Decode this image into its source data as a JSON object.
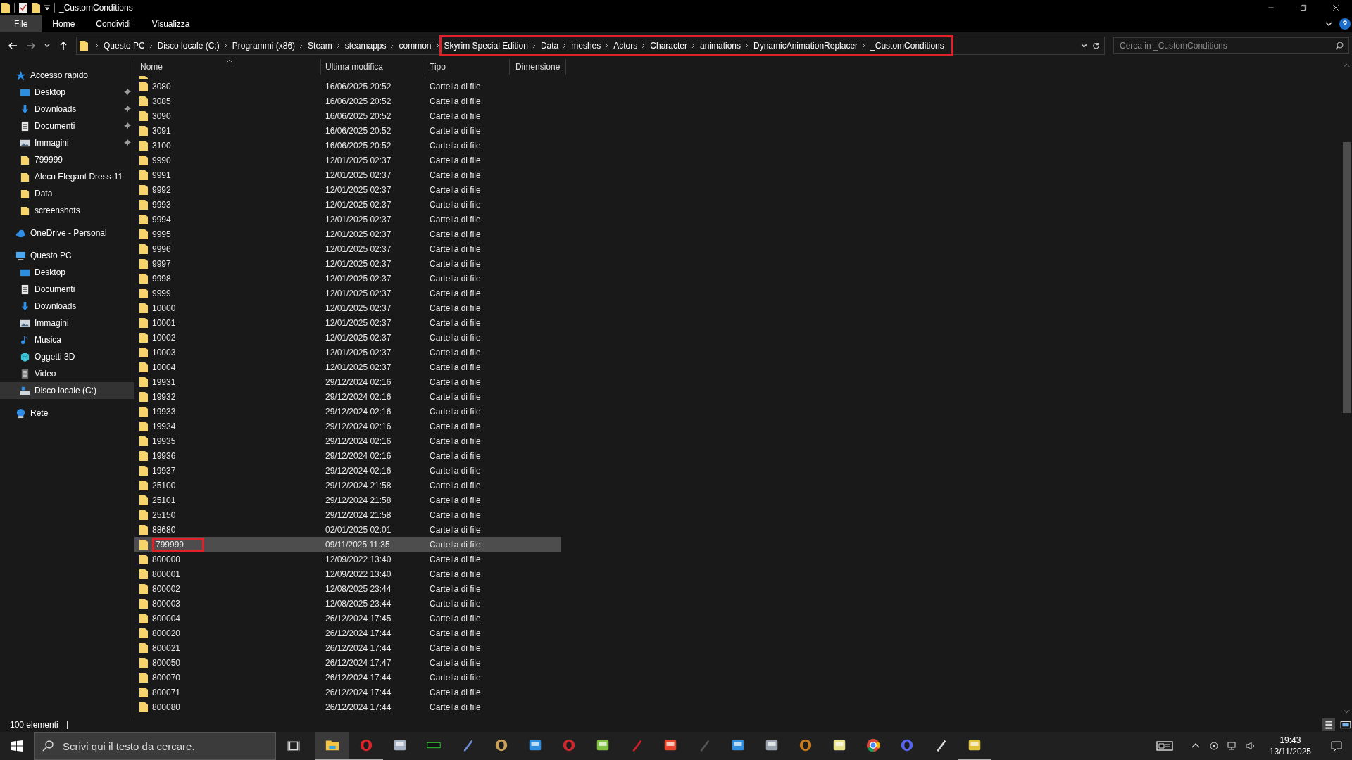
{
  "window": {
    "title": "_CustomConditions"
  },
  "ribbon_tabs": [
    {
      "label": "File",
      "selected": true
    },
    {
      "label": "Home",
      "selected": false
    },
    {
      "label": "Condividi",
      "selected": false
    },
    {
      "label": "Visualizza",
      "selected": false
    }
  ],
  "breadcrumbs": [
    {
      "label": "Questo PC",
      "highlighted": false
    },
    {
      "label": "Disco locale (C:)",
      "highlighted": false
    },
    {
      "label": "Programmi (x86)",
      "highlighted": false
    },
    {
      "label": "Steam",
      "highlighted": false
    },
    {
      "label": "steamapps",
      "highlighted": false
    },
    {
      "label": "common",
      "highlighted": false
    },
    {
      "label": "Skyrim Special Edition",
      "highlighted": true
    },
    {
      "label": "Data",
      "highlighted": true
    },
    {
      "label": "meshes",
      "highlighted": true
    },
    {
      "label": "Actors",
      "highlighted": true
    },
    {
      "label": "Character",
      "highlighted": true
    },
    {
      "label": "animations",
      "highlighted": true
    },
    {
      "label": "DynamicAnimationReplacer",
      "highlighted": true
    },
    {
      "label": "_CustomConditions",
      "highlighted": true
    }
  ],
  "search": {
    "placeholder": "Cerca in _CustomConditions"
  },
  "sidebar": [
    {
      "label": "Accesso rapido",
      "kind": "star",
      "selected": false,
      "children": [
        {
          "label": "Desktop",
          "kind": "desktop",
          "pinned": true,
          "selected": false
        },
        {
          "label": "Downloads",
          "kind": "download",
          "pinned": true,
          "selected": false
        },
        {
          "label": "Documenti",
          "kind": "document",
          "pinned": true,
          "selected": false
        },
        {
          "label": "Immagini",
          "kind": "image",
          "pinned": true,
          "selected": false
        },
        {
          "label": "799999",
          "kind": "folder",
          "pinned": false,
          "selected": false
        },
        {
          "label": "Alecu Elegant Dress-11",
          "kind": "folder",
          "pinned": false,
          "selected": false
        },
        {
          "label": "Data",
          "kind": "folder",
          "pinned": false,
          "selected": false
        },
        {
          "label": "screenshots",
          "kind": "folder",
          "pinned": false,
          "selected": false
        }
      ]
    },
    {
      "label": "OneDrive - Personal",
      "kind": "cloud",
      "selected": false
    },
    {
      "label": "Questo PC",
      "kind": "pc",
      "selected": false,
      "children": [
        {
          "label": "Desktop",
          "kind": "desktop",
          "pinned": false,
          "selected": false
        },
        {
          "label": "Documenti",
          "kind": "document",
          "pinned": false,
          "selected": false
        },
        {
          "label": "Downloads",
          "kind": "download",
          "pinned": false,
          "selected": false
        },
        {
          "label": "Immagini",
          "kind": "image",
          "pinned": false,
          "selected": false
        },
        {
          "label": "Musica",
          "kind": "music",
          "pinned": false,
          "selected": false
        },
        {
          "label": "Oggetti 3D",
          "kind": "cube",
          "pinned": false,
          "selected": false
        },
        {
          "label": "Video",
          "kind": "video",
          "pinned": false,
          "selected": false
        },
        {
          "label": "Disco locale (C:)",
          "kind": "drive",
          "pinned": false,
          "selected": true
        }
      ]
    },
    {
      "label": "Rete",
      "kind": "network",
      "selected": false
    }
  ],
  "columns": [
    "Nome",
    "Ultima modifica",
    "Tipo",
    "Dimensione"
  ],
  "rows": [
    {
      "name": "3080",
      "modified": "16/06/2025 20:52",
      "type": "Cartella di file",
      "selected": false,
      "highlighted": false
    },
    {
      "name": "3085",
      "modified": "16/06/2025 20:52",
      "type": "Cartella di file",
      "selected": false,
      "highlighted": false
    },
    {
      "name": "3090",
      "modified": "16/06/2025 20:52",
      "type": "Cartella di file",
      "selected": false,
      "highlighted": false
    },
    {
      "name": "3091",
      "modified": "16/06/2025 20:52",
      "type": "Cartella di file",
      "selected": false,
      "highlighted": false
    },
    {
      "name": "3100",
      "modified": "16/06/2025 20:52",
      "type": "Cartella di file",
      "selected": false,
      "highlighted": false
    },
    {
      "name": "9990",
      "modified": "12/01/2025 02:37",
      "type": "Cartella di file",
      "selected": false,
      "highlighted": false
    },
    {
      "name": "9991",
      "modified": "12/01/2025 02:37",
      "type": "Cartella di file",
      "selected": false,
      "highlighted": false
    },
    {
      "name": "9992",
      "modified": "12/01/2025 02:37",
      "type": "Cartella di file",
      "selected": false,
      "highlighted": false
    },
    {
      "name": "9993",
      "modified": "12/01/2025 02:37",
      "type": "Cartella di file",
      "selected": false,
      "highlighted": false
    },
    {
      "name": "9994",
      "modified": "12/01/2025 02:37",
      "type": "Cartella di file",
      "selected": false,
      "highlighted": false
    },
    {
      "name": "9995",
      "modified": "12/01/2025 02:37",
      "type": "Cartella di file",
      "selected": false,
      "highlighted": false
    },
    {
      "name": "9996",
      "modified": "12/01/2025 02:37",
      "type": "Cartella di file",
      "selected": false,
      "highlighted": false
    },
    {
      "name": "9997",
      "modified": "12/01/2025 02:37",
      "type": "Cartella di file",
      "selected": false,
      "highlighted": false
    },
    {
      "name": "9998",
      "modified": "12/01/2025 02:37",
      "type": "Cartella di file",
      "selected": false,
      "highlighted": false
    },
    {
      "name": "9999",
      "modified": "12/01/2025 02:37",
      "type": "Cartella di file",
      "selected": false,
      "highlighted": false
    },
    {
      "name": "10000",
      "modified": "12/01/2025 02:37",
      "type": "Cartella di file",
      "selected": false,
      "highlighted": false
    },
    {
      "name": "10001",
      "modified": "12/01/2025 02:37",
      "type": "Cartella di file",
      "selected": false,
      "highlighted": false
    },
    {
      "name": "10002",
      "modified": "12/01/2025 02:37",
      "type": "Cartella di file",
      "selected": false,
      "highlighted": false
    },
    {
      "name": "10003",
      "modified": "12/01/2025 02:37",
      "type": "Cartella di file",
      "selected": false,
      "highlighted": false
    },
    {
      "name": "10004",
      "modified": "12/01/2025 02:37",
      "type": "Cartella di file",
      "selected": false,
      "highlighted": false
    },
    {
      "name": "19931",
      "modified": "29/12/2024 02:16",
      "type": "Cartella di file",
      "selected": false,
      "highlighted": false
    },
    {
      "name": "19932",
      "modified": "29/12/2024 02:16",
      "type": "Cartella di file",
      "selected": false,
      "highlighted": false
    },
    {
      "name": "19933",
      "modified": "29/12/2024 02:16",
      "type": "Cartella di file",
      "selected": false,
      "highlighted": false
    },
    {
      "name": "19934",
      "modified": "29/12/2024 02:16",
      "type": "Cartella di file",
      "selected": false,
      "highlighted": false
    },
    {
      "name": "19935",
      "modified": "29/12/2024 02:16",
      "type": "Cartella di file",
      "selected": false,
      "highlighted": false
    },
    {
      "name": "19936",
      "modified": "29/12/2024 02:16",
      "type": "Cartella di file",
      "selected": false,
      "highlighted": false
    },
    {
      "name": "19937",
      "modified": "29/12/2024 02:16",
      "type": "Cartella di file",
      "selected": false,
      "highlighted": false
    },
    {
      "name": "25100",
      "modified": "29/12/2024 21:58",
      "type": "Cartella di file",
      "selected": false,
      "highlighted": false
    },
    {
      "name": "25101",
      "modified": "29/12/2024 21:58",
      "type": "Cartella di file",
      "selected": false,
      "highlighted": false
    },
    {
      "name": "25150",
      "modified": "29/12/2024 21:58",
      "type": "Cartella di file",
      "selected": false,
      "highlighted": false
    },
    {
      "name": "88680",
      "modified": "02/01/2025 02:01",
      "type": "Cartella di file",
      "selected": false,
      "highlighted": false
    },
    {
      "name": "799999",
      "modified": "09/11/2025 11:35",
      "type": "Cartella di file",
      "selected": true,
      "highlighted": true
    },
    {
      "name": "800000",
      "modified": "12/09/2022 13:40",
      "type": "Cartella di file",
      "selected": false,
      "highlighted": false
    },
    {
      "name": "800001",
      "modified": "12/09/2022 13:40",
      "type": "Cartella di file",
      "selected": false,
      "highlighted": false
    },
    {
      "name": "800002",
      "modified": "12/08/2025 23:44",
      "type": "Cartella di file",
      "selected": false,
      "highlighted": false
    },
    {
      "name": "800003",
      "modified": "12/08/2025 23:44",
      "type": "Cartella di file",
      "selected": false,
      "highlighted": false
    },
    {
      "name": "800004",
      "modified": "26/12/2024 17:45",
      "type": "Cartella di file",
      "selected": false,
      "highlighted": false
    },
    {
      "name": "800020",
      "modified": "26/12/2024 17:44",
      "type": "Cartella di file",
      "selected": false,
      "highlighted": false
    },
    {
      "name": "800021",
      "modified": "26/12/2024 17:44",
      "type": "Cartella di file",
      "selected": false,
      "highlighted": false
    },
    {
      "name": "800050",
      "modified": "26/12/2024 17:47",
      "type": "Cartella di file",
      "selected": false,
      "highlighted": false
    },
    {
      "name": "800070",
      "modified": "26/12/2024 17:44",
      "type": "Cartella di file",
      "selected": false,
      "highlighted": false
    },
    {
      "name": "800071",
      "modified": "26/12/2024 17:44",
      "type": "Cartella di file",
      "selected": false,
      "highlighted": false
    },
    {
      "name": "800080",
      "modified": "26/12/2024 17:44",
      "type": "Cartella di file",
      "selected": false,
      "highlighted": false
    }
  ],
  "status_bar": {
    "item_count": "100 elementi"
  },
  "taskbar": {
    "search_placeholder": "Scrivi qui il testo da cercare.",
    "apps": [
      {
        "running": true,
        "active": true
      },
      {
        "running": true,
        "active": false
      },
      {
        "running": false,
        "active": false
      },
      {
        "running": false,
        "active": false
      },
      {
        "running": false,
        "active": false
      },
      {
        "running": false,
        "active": false
      },
      {
        "running": false,
        "active": false
      },
      {
        "running": false,
        "active": false
      },
      {
        "running": false,
        "active": false
      },
      {
        "running": false,
        "active": false
      },
      {
        "running": false,
        "active": false
      },
      {
        "running": false,
        "active": false
      },
      {
        "running": false,
        "active": false
      },
      {
        "running": false,
        "active": false
      },
      {
        "running": false,
        "active": false
      },
      {
        "running": false,
        "active": false
      },
      {
        "running": false,
        "active": false
      },
      {
        "running": false,
        "active": false
      },
      {
        "running": false,
        "active": false
      },
      {
        "running": true,
        "active": false
      }
    ],
    "time": "19:43",
    "date": "13/11/2025"
  }
}
